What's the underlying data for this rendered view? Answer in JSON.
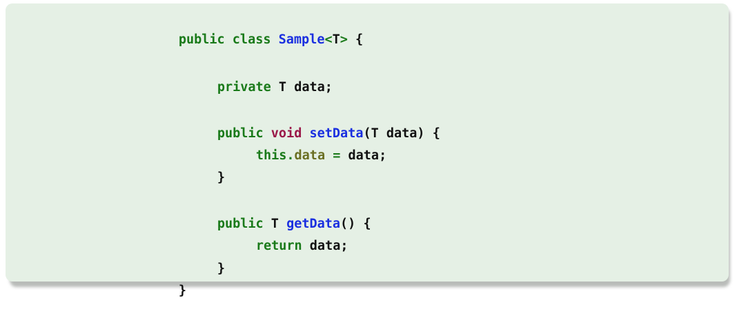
{
  "code_block": {
    "lines": [
      [
        "public",
        " ",
        "class",
        " ",
        "Sample",
        "<",
        "T",
        ">",
        " {"
      ],
      [
        "private",
        " T data;"
      ],
      [
        "public",
        " ",
        "void",
        " ",
        "setData",
        "(T data) {"
      ],
      [
        "this",
        ".",
        "data",
        " ",
        "=",
        " data;"
      ],
      [
        "}"
      ],
      [
        "public",
        " T ",
        "getData",
        "() {"
      ],
      [
        "return",
        " data;"
      ],
      [
        "}"
      ],
      [
        "}"
      ]
    ]
  },
  "colors": {
    "background": "#e5f0e5",
    "keyword": "#1a7a1a",
    "void": "#9a1848",
    "method_or_class": "#1a2fe0",
    "field": "#6b6f23",
    "text": "#111111"
  }
}
